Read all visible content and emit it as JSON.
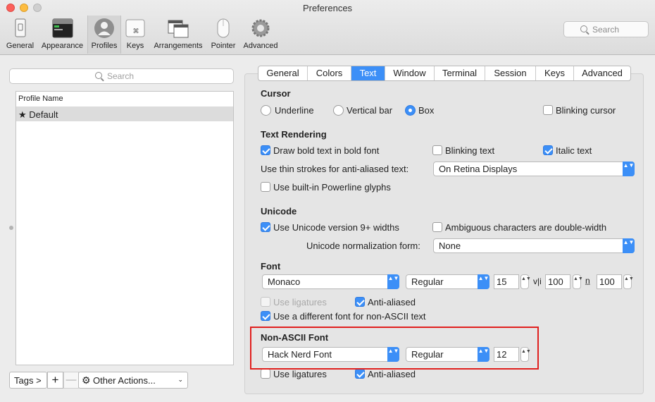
{
  "window": {
    "title": "Preferences"
  },
  "toolbar": {
    "items": [
      {
        "label": "General",
        "icon": "general-icon"
      },
      {
        "label": "Appearance",
        "icon": "appearance-icon"
      },
      {
        "label": "Profiles",
        "icon": "profiles-icon"
      },
      {
        "label": "Keys",
        "icon": "keys-icon"
      },
      {
        "label": "Arrangements",
        "icon": "arrangements-icon"
      },
      {
        "label": "Pointer",
        "icon": "pointer-icon"
      },
      {
        "label": "Advanced",
        "icon": "advanced-icon"
      }
    ],
    "active": "Profiles",
    "search_placeholder": "Search"
  },
  "sidebar": {
    "search_placeholder": "Search",
    "column_header": "Profile Name",
    "profiles": [
      "★ Default"
    ],
    "tags_button": "Tags >",
    "add_button": "+",
    "remove_button": "—",
    "other_actions": "Other Actions...",
    "other_actions_chevron": "⌄"
  },
  "tabs": {
    "items": [
      "General",
      "Colors",
      "Text",
      "Window",
      "Terminal",
      "Session",
      "Keys",
      "Advanced"
    ],
    "active": "Text"
  },
  "cursor": {
    "title": "Cursor",
    "underline": "Underline",
    "vertical_bar": "Vertical bar",
    "box": "Box",
    "selected": "Box",
    "blinking_cursor": "Blinking cursor"
  },
  "text_rendering": {
    "title": "Text Rendering",
    "bold_in_bold": "Draw bold text in bold font",
    "blinking_text": "Blinking text",
    "italic_text": "Italic text",
    "thin_strokes_label": "Use thin strokes for anti-aliased text:",
    "thin_strokes_value": "On Retina Displays",
    "powerline": "Use built-in Powerline glyphs"
  },
  "unicode": {
    "title": "Unicode",
    "version9": "Use Unicode version 9+ widths",
    "ambiguous": "Ambiguous characters are double-width",
    "normalization_label": "Unicode normalization form:",
    "normalization_value": "None"
  },
  "font": {
    "title": "Font",
    "family": "Monaco",
    "weight": "Regular",
    "size": "15",
    "h_spacing_icon": "v|i",
    "h_spacing": "100",
    "v_spacing_icon": "n̲",
    "v_spacing": "100",
    "use_ligatures": "Use ligatures",
    "anti_aliased": "Anti-aliased",
    "different_non_ascii": "Use a different font for non-ASCII text"
  },
  "non_ascii_font": {
    "title": "Non-ASCII Font",
    "family": "Hack Nerd Font",
    "weight": "Regular",
    "size": "12",
    "use_ligatures": "Use ligatures",
    "anti_aliased": "Anti-aliased"
  },
  "glyphs": {
    "up_down": "▲▼",
    "gear": "⚙"
  },
  "colors": {
    "accent": "#3c8ff7",
    "highlight_box": "#e0201e"
  }
}
